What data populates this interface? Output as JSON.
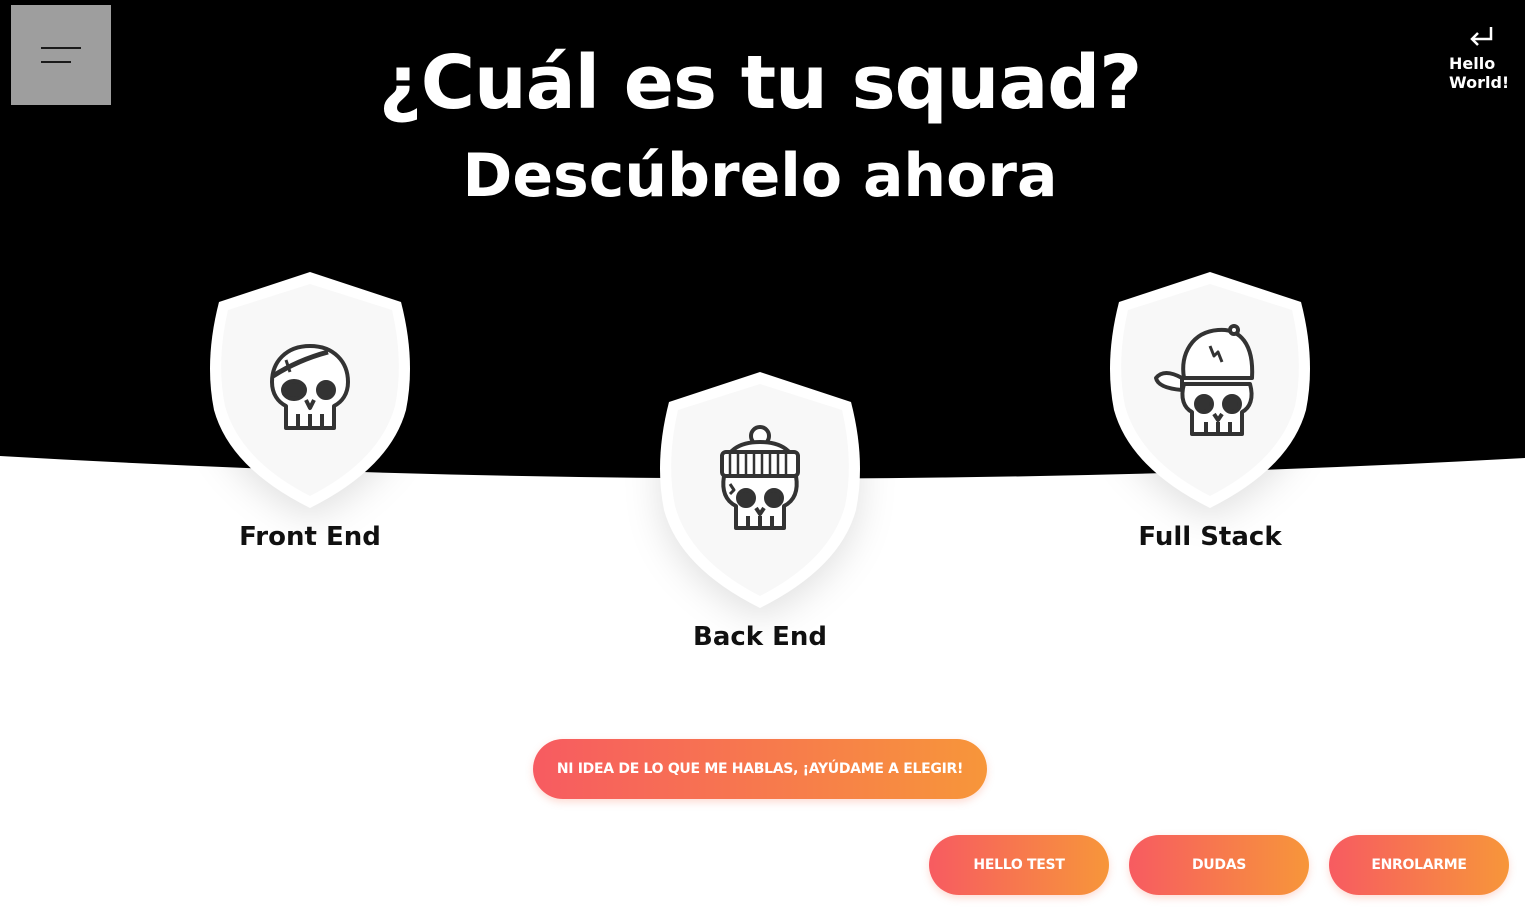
{
  "header": {
    "title": "¿Cuál es tu squad?",
    "subtitle": "Descúbrelo ahora",
    "exit_label": "Hello World!"
  },
  "squads": [
    {
      "label": "Front End",
      "icon": "skull-eyepatch-icon"
    },
    {
      "label": "Back End",
      "icon": "skull-beanie-icon"
    },
    {
      "label": "Full Stack",
      "icon": "skull-cap-icon"
    }
  ],
  "help_button": "NI IDEA DE LO QUE ME HABLAS, ¡AYÚDAME A ELEGIR!",
  "footer_buttons": [
    {
      "label": "HELLO TEST"
    },
    {
      "label": "DUDAS"
    },
    {
      "label": "ENROLARME"
    }
  ],
  "colors": {
    "hero_background": "#000000",
    "gradient_start": "#f75b61",
    "gradient_end": "#f7963a"
  }
}
